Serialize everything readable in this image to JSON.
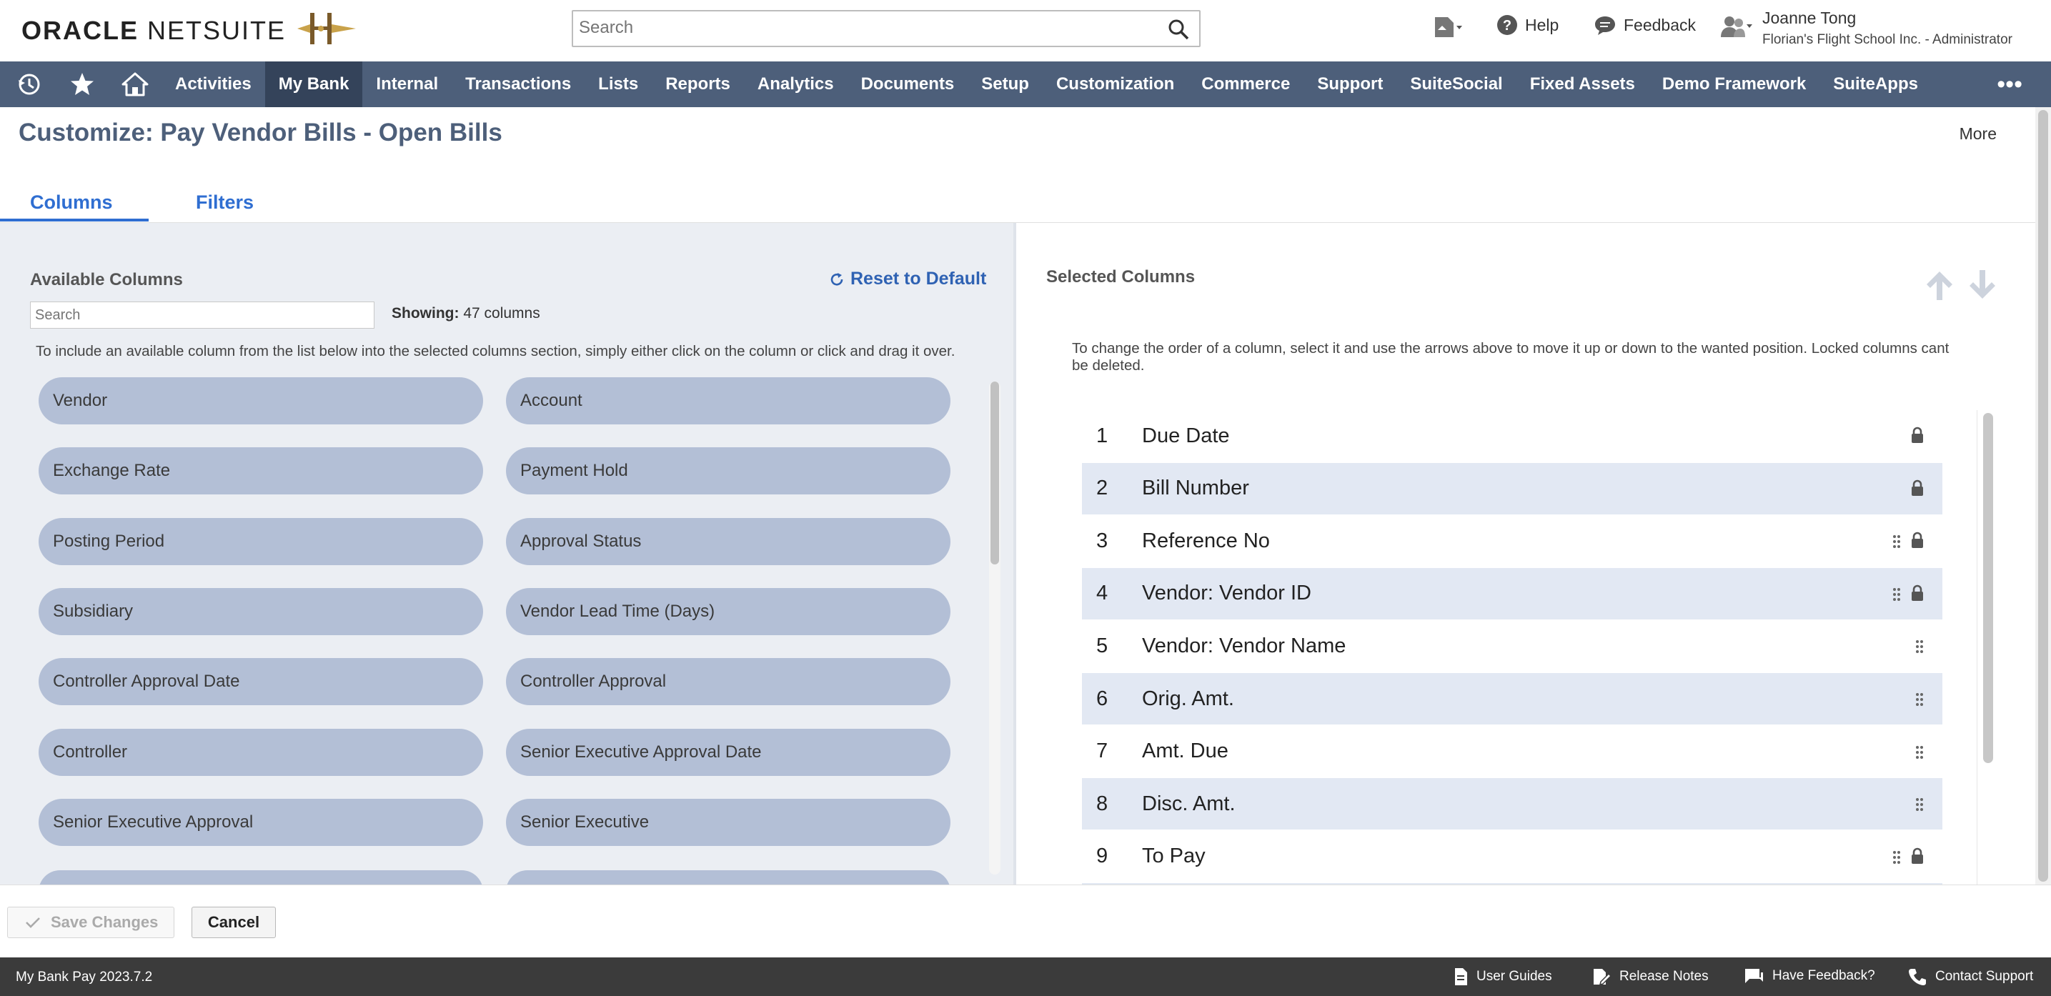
{
  "header": {
    "brand_bold": "ORACLE",
    "brand_light": "NETSUITE",
    "search_placeholder": "Search",
    "help_label": "Help",
    "feedback_label": "Feedback",
    "user_name": "Joanne Tong",
    "user_role": "Florian's Flight School Inc. - Administrator"
  },
  "nav": {
    "items": [
      "Activities",
      "My Bank",
      "Internal",
      "Transactions",
      "Lists",
      "Reports",
      "Analytics",
      "Documents",
      "Setup",
      "Customization",
      "Commerce",
      "Support",
      "SuiteSocial",
      "Fixed Assets",
      "Demo Framework",
      "SuiteApps"
    ],
    "active": "My Bank",
    "more_glyph": "•••"
  },
  "page": {
    "title": "Customize: Pay Vendor Bills - Open Bills",
    "more_label": "More",
    "tabs": [
      "Columns",
      "Filters"
    ],
    "active_tab": "Columns"
  },
  "available": {
    "heading": "Available Columns",
    "reset_label": "Reset to Default",
    "search_placeholder": "Search",
    "showing_label": "Showing:",
    "showing_value": "47 columns",
    "instructions": "To include an available column from the list below into the selected columns section, simply either click on the column or click and drag it over.",
    "columns": [
      "Vendor",
      "Account",
      "Exchange Rate",
      "Payment Hold",
      "Posting Period",
      "Approval Status",
      "Subsidiary",
      "Vendor Lead Time (Days)",
      "Controller Approval Date",
      "Controller Approval",
      "Controller",
      "Senior Executive Approval Date",
      "Senior Executive Approval",
      "Senior Executive"
    ]
  },
  "selected": {
    "heading": "Selected Columns",
    "instructions": "To change the order of a column, select it and use the arrows above to move it up or down to the wanted position. Locked columns cant be deleted.",
    "rows": [
      {
        "num": "1",
        "label": "Due Date",
        "drag": false,
        "locked": true
      },
      {
        "num": "2",
        "label": "Bill Number",
        "drag": false,
        "locked": true
      },
      {
        "num": "3",
        "label": "Reference No",
        "drag": true,
        "locked": true
      },
      {
        "num": "4",
        "label": "Vendor: Vendor ID",
        "drag": true,
        "locked": true
      },
      {
        "num": "5",
        "label": "Vendor: Vendor Name",
        "drag": true,
        "locked": false
      },
      {
        "num": "6",
        "label": "Orig. Amt.",
        "drag": true,
        "locked": false
      },
      {
        "num": "7",
        "label": "Amt. Due",
        "drag": true,
        "locked": false
      },
      {
        "num": "8",
        "label": "Disc. Amt.",
        "drag": true,
        "locked": false
      },
      {
        "num": "9",
        "label": "To Pay",
        "drag": true,
        "locked": true
      }
    ]
  },
  "actions": {
    "save_label": "Save Changes",
    "cancel_label": "Cancel"
  },
  "footer": {
    "version": "My Bank Pay 2023.7.2",
    "links": [
      "User Guides",
      "Release Notes",
      "Have Feedback?",
      "Contact Support"
    ]
  },
  "colors": {
    "nav_bg": "#4d5f7a",
    "nav_active": "#34435a",
    "accent_blue": "#2f6ed1",
    "chip_bg": "#b3bfd6",
    "row_alt": "#e2e8f3",
    "status_bar": "#3b3b3b"
  }
}
